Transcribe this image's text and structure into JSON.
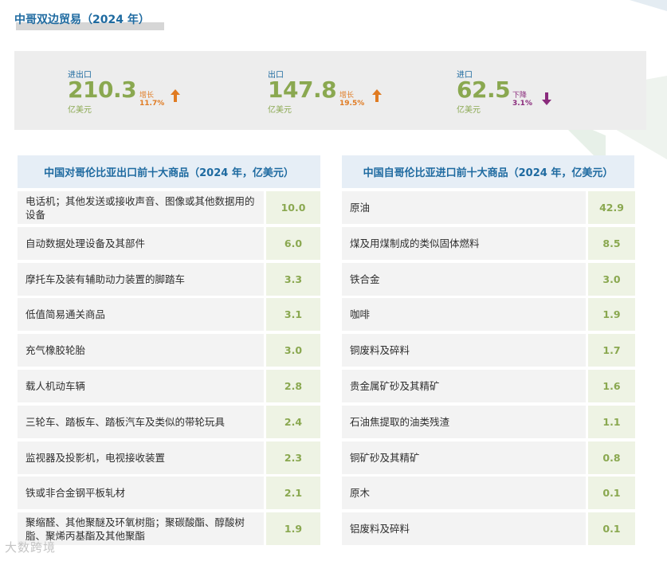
{
  "title": "中哥双边贸易（2024 年）",
  "summary": [
    {
      "label": "进出口",
      "value": "210.3",
      "unit": "亿美元",
      "trend_label": "增长",
      "trend_pct": "11.7%",
      "direction": "up"
    },
    {
      "label": "出口",
      "value": "147.8",
      "unit": "亿美元",
      "trend_label": "增长",
      "trend_pct": "19.5%",
      "direction": "up"
    },
    {
      "label": "进口",
      "value": "62.5",
      "unit": "亿美元",
      "trend_label": "下降",
      "trend_pct": "3.1%",
      "direction": "down"
    }
  ],
  "exports_table": {
    "title": "中国对哥伦比亚出口前十大商品（2024 年，亿美元）",
    "rows": [
      {
        "name": "电话机；其他发送或接收声音、图像或其他数据用的设备",
        "value": "10.0"
      },
      {
        "name": "自动数据处理设备及其部件",
        "value": "6.0"
      },
      {
        "name": "摩托车及装有辅助动力装置的脚踏车",
        "value": "3.3"
      },
      {
        "name": "低值简易通关商品",
        "value": "3.1"
      },
      {
        "name": "充气橡胶轮胎",
        "value": "3.0"
      },
      {
        "name": "载人机动车辆",
        "value": "2.8"
      },
      {
        "name": "三轮车、踏板车、踏板汽车及类似的带轮玩具",
        "value": "2.4"
      },
      {
        "name": "监视器及投影机，电视接收装置",
        "value": "2.3"
      },
      {
        "name": "铁或非合金钢平板轧材",
        "value": "2.1"
      },
      {
        "name": "聚缩醛、其他聚醚及环氧树脂；聚碳酸酯、醇酸树脂、聚烯丙基酯及其他聚酯",
        "value": "1.9"
      }
    ]
  },
  "imports_table": {
    "title": "中国自哥伦比亚进口前十大商品（2024 年，亿美元）",
    "rows": [
      {
        "name": "原油",
        "value": "42.9"
      },
      {
        "name": "煤及用煤制成的类似固体燃料",
        "value": "8.5"
      },
      {
        "name": "铁合金",
        "value": "3.0"
      },
      {
        "name": "咖啡",
        "value": "1.9"
      },
      {
        "name": "铜废料及碎料",
        "value": "1.7"
      },
      {
        "name": "贵金属矿砂及其精矿",
        "value": "1.6"
      },
      {
        "name": "石油焦提取的油类残渣",
        "value": "1.1"
      },
      {
        "name": "铜矿砂及其精矿",
        "value": "0.8"
      },
      {
        "name": "原木",
        "value": "0.1"
      },
      {
        "name": "铝废料及碎料",
        "value": "0.1"
      }
    ]
  },
  "watermark": "大数跨境",
  "colors": {
    "blue": "#1e6aa0",
    "green": "#8aa850",
    "orange": "#e07b22",
    "purple": "#8a2b7c"
  }
}
